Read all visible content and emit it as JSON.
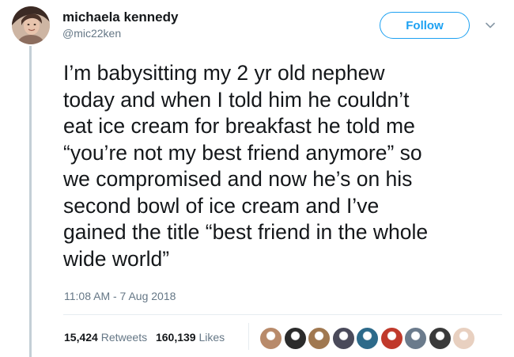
{
  "author": {
    "name": "michaela kennedy",
    "handle": "@mic22ken"
  },
  "follow_label": "Follow",
  "tweet": {
    "text": "I’m babysitting my 2 yr old nephew\ntoday and when I told him he couldn’t\neat ice cream for breakfast he told me\n“you’re not my best friend anymore” so\nwe compromised and now he’s on his\nsecond bowl of ice cream and I’ve\ngained the title “best friend in the whole\nwide world”",
    "timestamp": "11:08 AM - 7 Aug 2018"
  },
  "stats": {
    "retweets_count": "15,424",
    "retweets_label": "Retweets",
    "likes_count": "160,139",
    "likes_label": "Likes"
  },
  "colors": {
    "accent": "#1da1f2",
    "secondary_text": "#657786",
    "primary_text": "#14171a",
    "divider": "#e6ecf0"
  },
  "icons": {
    "menu": "chevron-down-icon"
  },
  "liker_avatars": [
    {
      "color": "#b88a6a"
    },
    {
      "color": "#2b2b2b"
    },
    {
      "color": "#a07850"
    },
    {
      "color": "#4a4a5a"
    },
    {
      "color": "#2d6a8a"
    },
    {
      "color": "#c0392b"
    },
    {
      "color": "#6b7b8c"
    },
    {
      "color": "#3a3a3a"
    },
    {
      "color": "#e8d0c0"
    }
  ]
}
